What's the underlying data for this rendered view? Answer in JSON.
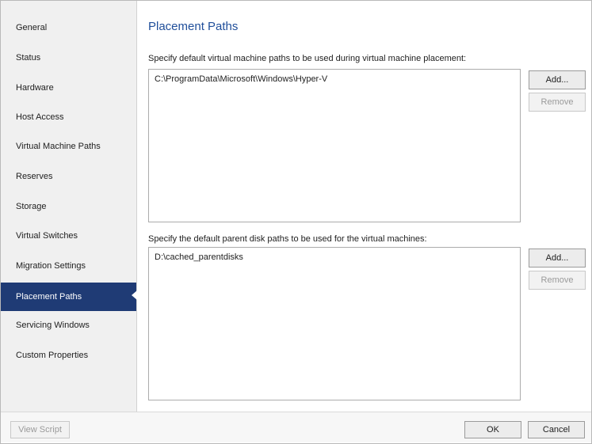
{
  "sidebar": {
    "items": [
      {
        "label": "General"
      },
      {
        "label": "Status"
      },
      {
        "label": "Hardware"
      },
      {
        "label": "Host Access"
      },
      {
        "label": "Virtual Machine Paths"
      },
      {
        "label": "Reserves"
      },
      {
        "label": "Storage"
      },
      {
        "label": "Virtual Switches"
      },
      {
        "label": "Migration Settings"
      },
      {
        "label": "Placement Paths"
      },
      {
        "label": "Servicing Windows"
      },
      {
        "label": "Custom Properties"
      }
    ],
    "active": "Placement Paths"
  },
  "main": {
    "title": "Placement Paths",
    "vm_paths": {
      "description": "Specify default virtual machine paths to be used during virtual machine placement:",
      "entries": [
        "C:\\ProgramData\\Microsoft\\Windows\\Hyper-V"
      ],
      "add_label": "Add...",
      "remove_label": "Remove"
    },
    "parent_disk_paths": {
      "description": "Specify the default parent disk paths to be used for the virtual machines:",
      "entries": [
        "D:\\cached_parentdisks"
      ],
      "add_label": "Add...",
      "remove_label": "Remove"
    }
  },
  "footer": {
    "view_script_label": "View Script",
    "ok_label": "OK",
    "cancel_label": "Cancel"
  },
  "colors": {
    "active_nav_bg": "#1f3b75",
    "title": "#1f4e9a",
    "sidebar_bg": "#f0f0f0"
  }
}
